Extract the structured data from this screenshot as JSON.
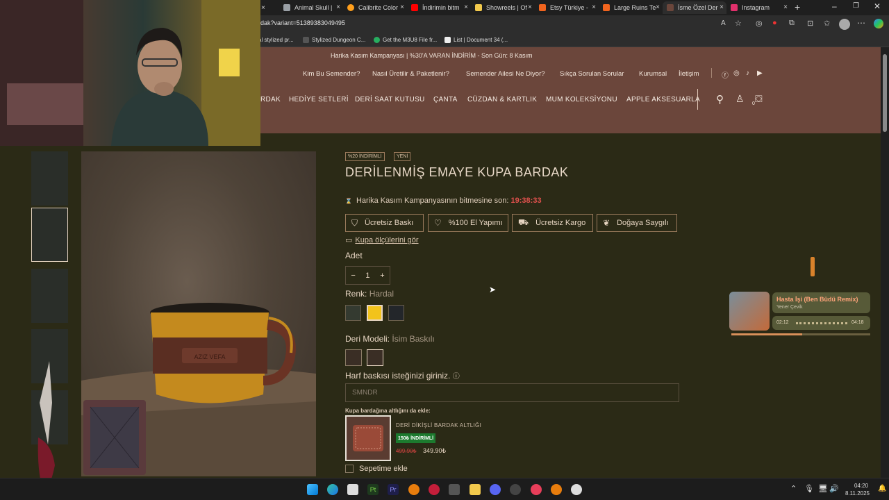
{
  "browser": {
    "tabs": [
      {
        "label": "Animal Skull |",
        "color": "#9aa0a6"
      },
      {
        "label": "Calibrite Color",
        "color": "#ff9f1c"
      },
      {
        "label": "İndirimin bitm",
        "color": "#ff0000"
      },
      {
        "label": "Showreels | Of",
        "color": "#f2c94c"
      },
      {
        "label": "Etsy Türkiye -",
        "color": "#f1641e"
      },
      {
        "label": "Large Ruins Te",
        "color": "#f1641e"
      },
      {
        "label": "İsme Özel Der",
        "color": "#6b463b"
      },
      {
        "label": "Instagram",
        "color": "#e1306c"
      }
    ],
    "url": "rdak?variant=51389383049495",
    "bookmarks": [
      "al stylized pr...",
      "Stylized Dungeon C...",
      "Get the M3U8 File fr...",
      "List | Document 34 (..."
    ]
  },
  "site": {
    "promo": "Harika Kasım Kampanyası | %30'A VARAN İNDİRİM - Son Gün: 8 Kasım",
    "toplinks": [
      "Kim Bu Semender?",
      "Nasıl Üretilir & Paketlenir?",
      "Semender Ailesi Ne Diyor?",
      "Sıkça Sorulan Sorular",
      "Kurumsal",
      "İletişim"
    ],
    "nav": [
      "RDAK",
      "HEDİYE SETLERİ",
      "DERİ SAAT KUTUSU",
      "ÇANTA",
      "CÜZDAN & KARTLIK",
      "MUM KOLEKSİYONU",
      "APPLE AKSESUARLA"
    ],
    "cart_count": "0"
  },
  "product": {
    "badges": [
      "%20 İNDİRİMLİ",
      "YENİ"
    ],
    "title": "DERİLENMİŞ EMAYE KUPA BARDAK",
    "countdown_label": "Harika Kasım Kampanyasının bitmesine son:",
    "countdown_time": "19:38:33",
    "features": [
      "Ücretsiz Baskı",
      "%100 El Yapımı",
      "Ücretsiz Kargo",
      "Doğaya Saygılı"
    ],
    "size_link": "Kupa ölçülerini gör",
    "qty_label": "Adet",
    "qty_value": "1",
    "color_label": "Renk:",
    "color_value": "Hardal",
    "colors": [
      "#343a30",
      "#f2c31b",
      "#23262a"
    ],
    "model_label": "Deri Modeli:",
    "model_value": "İsim Baskılı",
    "engrave_label": "Harf baskısı isteğinizi giriniz.",
    "engrave_value": "SMNDR",
    "mug_text": "AZIZ VEFA"
  },
  "addon": {
    "title": "Kupa bardağına altlığını da ekle:",
    "name": "DERİ DİKİŞLİ BARDAK ALTLIĞI",
    "badge": "150₺ İNDİRİMLİ",
    "old_price": "499.90₺",
    "new_price": "349.90₺",
    "cart_label": "Sepetime ekle"
  },
  "music": {
    "title": "Hasta İşi (Ben Büdü Remix)",
    "artist": "Yener Çevik",
    "elapsed": "02:12",
    "total": "04:18",
    "progress": 0.51
  },
  "taskbar": {
    "time": "04:20",
    "date": "8.11.2025"
  }
}
